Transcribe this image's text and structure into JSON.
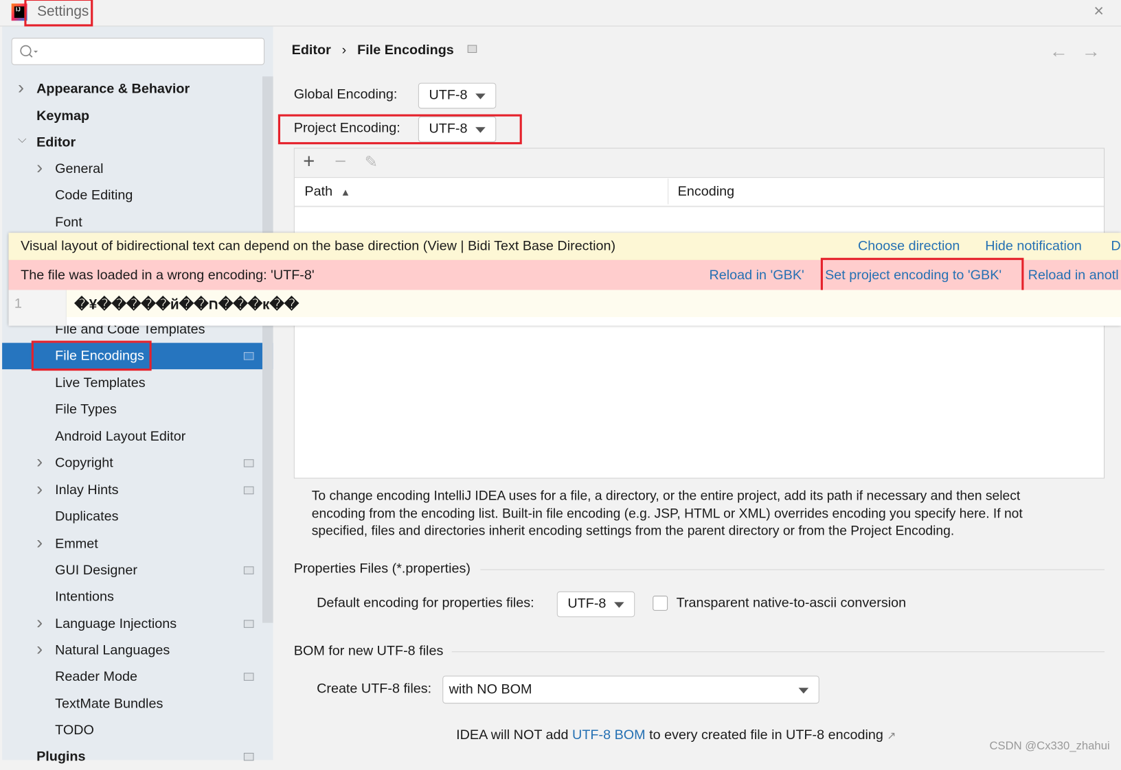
{
  "window": {
    "title": "Settings",
    "close_icon": "close-icon"
  },
  "search": {
    "placeholder": ""
  },
  "sidebar": {
    "items": [
      {
        "label": "Appearance & Behavior",
        "level": 0,
        "expandable": true,
        "bold": true
      },
      {
        "label": "Keymap",
        "level": 0,
        "bold": true
      },
      {
        "label": "Editor",
        "level": 0,
        "expanded": true,
        "bold": true
      },
      {
        "label": "General",
        "level": 1,
        "expandable": true
      },
      {
        "label": "Code Editing",
        "level": 1
      },
      {
        "label": "Font",
        "level": 1
      },
      {
        "label": "File and Code Templates",
        "level": 1
      },
      {
        "label": "File Encodings",
        "level": 1,
        "selected": true,
        "project": true
      },
      {
        "label": "Live Templates",
        "level": 1
      },
      {
        "label": "File Types",
        "level": 1
      },
      {
        "label": "Android Layout Editor",
        "level": 1
      },
      {
        "label": "Copyright",
        "level": 1,
        "expandable": true,
        "project": true
      },
      {
        "label": "Inlay Hints",
        "level": 1,
        "expandable": true,
        "project": true
      },
      {
        "label": "Duplicates",
        "level": 1
      },
      {
        "label": "Emmet",
        "level": 1,
        "expandable": true
      },
      {
        "label": "GUI Designer",
        "level": 1,
        "project": true
      },
      {
        "label": "Intentions",
        "level": 1
      },
      {
        "label": "Language Injections",
        "level": 1,
        "expandable": true,
        "project": true
      },
      {
        "label": "Natural Languages",
        "level": 1,
        "expandable": true
      },
      {
        "label": "Reader Mode",
        "level": 1,
        "project": true
      },
      {
        "label": "TextMate Bundles",
        "level": 1
      },
      {
        "label": "TODO",
        "level": 1
      },
      {
        "label": "Plugins",
        "level": 0,
        "bold": true,
        "project": true
      }
    ]
  },
  "breadcrumb": {
    "parent": "Editor",
    "separator": "›",
    "current": "File Encodings"
  },
  "encodings": {
    "global_label": "Global Encoding:",
    "global_value": "UTF-8",
    "project_label": "Project Encoding:",
    "project_value": "UTF-8"
  },
  "table": {
    "columns": [
      "Path",
      "Encoding"
    ],
    "sort": "ascending",
    "rows": []
  },
  "notifications": {
    "bidi": {
      "text": "Visual layout of bidirectional text can depend on the base direction (View | Bidi Text Base Direction)",
      "actions": [
        "Choose direction",
        "Hide notification",
        "D"
      ]
    },
    "encoding": {
      "text": "The file was loaded in a wrong encoding: 'UTF-8'",
      "actions": [
        "Reload in 'GBK'",
        "Set project encoding to 'GBK'",
        "Reload in anotl"
      ]
    },
    "editor": {
      "line_number": "1",
      "content": "�¥�����й��ח���к��"
    }
  },
  "help_text": "To change encoding IntelliJ IDEA uses for a file, a directory, or the entire project, add its path if necessary and then select encoding from the encoding list. Built-in file encoding (e.g. JSP, HTML or XML) overrides encoding you specify here. If not specified, files and directories inherit encoding settings from the parent directory or from the Project Encoding.",
  "properties": {
    "section": "Properties Files (*.properties)",
    "default_label": "Default encoding for properties files:",
    "default_value": "UTF-8",
    "transparent_label": "Transparent native-to-ascii conversion",
    "transparent_checked": false
  },
  "bom": {
    "section": "BOM for new UTF-8 files",
    "create_label": "Create UTF-8 files:",
    "create_value": "with NO BOM",
    "note_prefix": "IDEA will NOT add ",
    "note_link": "UTF-8 BOM",
    "note_suffix": " to every created file in UTF-8 encoding"
  },
  "watermark": "CSDN @Cx330_zhahui",
  "colors": {
    "accent": "#2675bf",
    "highlight": "#e5212b",
    "link": "#2470b3"
  }
}
